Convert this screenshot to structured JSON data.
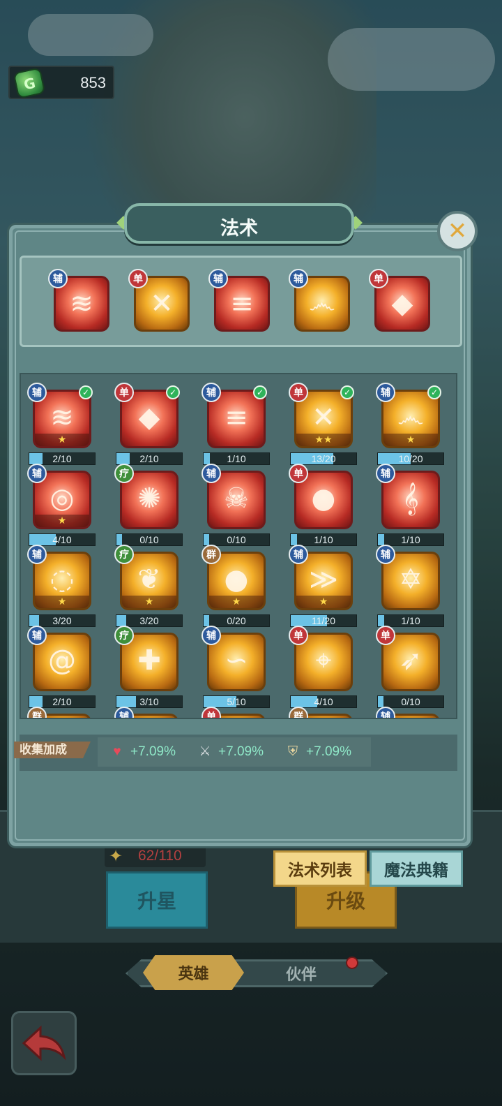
{
  "currency": {
    "icon": "green-gem-icon",
    "glyph": "G",
    "value": "853"
  },
  "popup": {
    "title": "法术",
    "close_glyph": "✕"
  },
  "equipped": [
    {
      "badge": "辅",
      "badge_type": "fu",
      "color": "red",
      "glyph": "≋"
    },
    {
      "badge": "单",
      "badge_type": "dan",
      "color": "gold",
      "glyph": "✕"
    },
    {
      "badge": "辅",
      "badge_type": "fu",
      "color": "red",
      "glyph": "≡"
    },
    {
      "badge": "辅",
      "badge_type": "fu",
      "color": "gold",
      "glyph": "෴"
    },
    {
      "badge": "单",
      "badge_type": "dan",
      "color": "red",
      "glyph": "◆"
    }
  ],
  "spells": [
    {
      "badge": "辅",
      "badge_type": "fu",
      "color": "red",
      "glyph": "≋",
      "stars": "★",
      "check": true,
      "progress": "2/10",
      "fill": 0.2
    },
    {
      "badge": "单",
      "badge_type": "dan",
      "color": "red",
      "glyph": "◆",
      "stars": "",
      "check": true,
      "progress": "2/10",
      "fill": 0.2
    },
    {
      "badge": "辅",
      "badge_type": "fu",
      "color": "red",
      "glyph": "≡",
      "stars": "",
      "check": true,
      "progress": "1/10",
      "fill": 0.1
    },
    {
      "badge": "单",
      "badge_type": "dan",
      "color": "gold",
      "glyph": "✕",
      "stars": "★★",
      "check": true,
      "progress": "13/20",
      "fill": 0.65
    },
    {
      "badge": "辅",
      "badge_type": "fu",
      "color": "gold",
      "glyph": "෴",
      "stars": "★",
      "check": true,
      "progress": "10/20",
      "fill": 0.5
    },
    {
      "badge": "辅",
      "badge_type": "fu",
      "color": "red",
      "glyph": "◎",
      "stars": "★",
      "check": false,
      "progress": "4/10",
      "fill": 0.4
    },
    {
      "badge": "疗",
      "badge_type": "liao",
      "color": "red",
      "glyph": "✺",
      "stars": "",
      "check": false,
      "progress": "0/10",
      "fill": 0
    },
    {
      "badge": "辅",
      "badge_type": "fu",
      "color": "red",
      "glyph": "☠",
      "stars": "",
      "check": false,
      "progress": "0/10",
      "fill": 0
    },
    {
      "badge": "单",
      "badge_type": "dan",
      "color": "red",
      "glyph": "●",
      "stars": "",
      "check": false,
      "progress": "1/10",
      "fill": 0.1
    },
    {
      "badge": "辅",
      "badge_type": "fu",
      "color": "red",
      "glyph": "𝄞",
      "stars": "",
      "check": false,
      "progress": "1/10",
      "fill": 0.1
    },
    {
      "badge": "辅",
      "badge_type": "fu",
      "color": "gold",
      "glyph": "◌",
      "stars": "★",
      "check": false,
      "progress": "3/20",
      "fill": 0.15
    },
    {
      "badge": "疗",
      "badge_type": "liao",
      "color": "gold",
      "glyph": "❦",
      "stars": "★",
      "check": false,
      "progress": "3/20",
      "fill": 0.15
    },
    {
      "badge": "群",
      "badge_type": "qun",
      "color": "gold",
      "glyph": "●",
      "stars": "★",
      "check": false,
      "progress": "0/20",
      "fill": 0
    },
    {
      "badge": "辅",
      "badge_type": "fu",
      "color": "gold",
      "glyph": "≫",
      "stars": "★",
      "check": false,
      "progress": "11/20",
      "fill": 0.55
    },
    {
      "badge": "辅",
      "badge_type": "fu",
      "color": "gold",
      "glyph": "✡",
      "stars": "",
      "check": false,
      "progress": "1/10",
      "fill": 0.1
    },
    {
      "badge": "辅",
      "badge_type": "fu",
      "color": "gold",
      "glyph": "@",
      "stars": "",
      "check": false,
      "progress": "2/10",
      "fill": 0.2
    },
    {
      "badge": "疗",
      "badge_type": "liao",
      "color": "gold",
      "glyph": "✚",
      "stars": "",
      "check": false,
      "progress": "3/10",
      "fill": 0.3
    },
    {
      "badge": "辅",
      "badge_type": "fu",
      "color": "gold",
      "glyph": "∽",
      "stars": "",
      "check": false,
      "progress": "5/10",
      "fill": 0.5
    },
    {
      "badge": "单",
      "badge_type": "dan",
      "color": "gold",
      "glyph": "⌖",
      "stars": "",
      "check": false,
      "progress": "4/10",
      "fill": 0.4
    },
    {
      "badge": "单",
      "badge_type": "dan",
      "color": "gold",
      "glyph": "➶",
      "stars": "",
      "check": false,
      "progress": "0/10",
      "fill": 0
    },
    {
      "badge": "群",
      "badge_type": "qun",
      "color": "gold",
      "glyph": "",
      "stars": "",
      "check": false,
      "progress": "",
      "fill": 0
    },
    {
      "badge": "辅",
      "badge_type": "fu",
      "color": "gold",
      "glyph": "",
      "stars": "",
      "check": false,
      "progress": "",
      "fill": 0
    },
    {
      "badge": "单",
      "badge_type": "dan",
      "color": "gold",
      "glyph": "",
      "stars": "",
      "check": false,
      "progress": "",
      "fill": 0
    },
    {
      "badge": "群",
      "badge_type": "qun",
      "color": "gold",
      "glyph": "",
      "stars": "",
      "check": false,
      "progress": "",
      "fill": 0
    },
    {
      "badge": "辅",
      "badge_type": "fu",
      "color": "gold",
      "glyph": "",
      "stars": "",
      "check": false,
      "progress": "",
      "fill": 0
    }
  ],
  "bonus": {
    "label": "收集加成",
    "hp": {
      "icon": "heart-icon",
      "glyph": "♥",
      "value": "+7.09%"
    },
    "atk": {
      "icon": "sword-icon",
      "glyph": "⚔",
      "value": "+7.09%"
    },
    "def": {
      "icon": "shield-icon",
      "glyph": "⛨",
      "value": "+7.09%"
    }
  },
  "tabs": {
    "spell_list": "法术列表",
    "magic_book": "魔法典籍"
  },
  "hero_screen": {
    "star_progress": "62/110",
    "star_up": "升星",
    "level_up": "升级"
  },
  "nav": {
    "hero": "英雄",
    "partner": "伙伴"
  },
  "colors": {
    "accent_gold": "#c9a14b",
    "panel": "#5f8686",
    "progress": "#6cc3e6"
  }
}
